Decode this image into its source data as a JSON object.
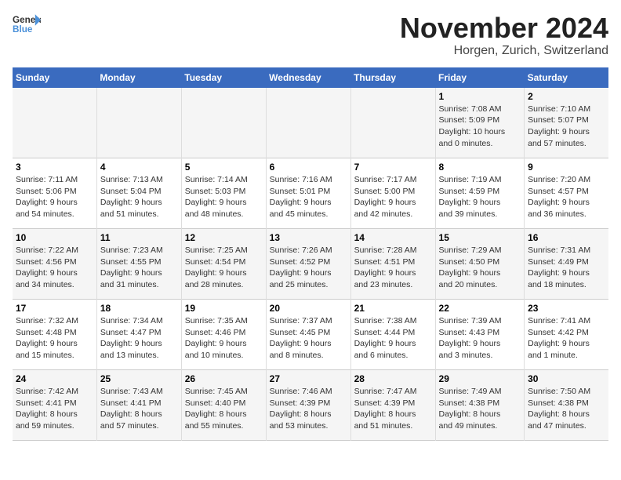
{
  "header": {
    "logo_line1": "General",
    "logo_line2": "Blue",
    "month": "November 2024",
    "location": "Horgen, Zurich, Switzerland"
  },
  "weekdays": [
    "Sunday",
    "Monday",
    "Tuesday",
    "Wednesday",
    "Thursday",
    "Friday",
    "Saturday"
  ],
  "weeks": [
    [
      {
        "day": "",
        "info": ""
      },
      {
        "day": "",
        "info": ""
      },
      {
        "day": "",
        "info": ""
      },
      {
        "day": "",
        "info": ""
      },
      {
        "day": "",
        "info": ""
      },
      {
        "day": "1",
        "info": "Sunrise: 7:08 AM\nSunset: 5:09 PM\nDaylight: 10 hours\nand 0 minutes."
      },
      {
        "day": "2",
        "info": "Sunrise: 7:10 AM\nSunset: 5:07 PM\nDaylight: 9 hours\nand 57 minutes."
      }
    ],
    [
      {
        "day": "3",
        "info": "Sunrise: 7:11 AM\nSunset: 5:06 PM\nDaylight: 9 hours\nand 54 minutes."
      },
      {
        "day": "4",
        "info": "Sunrise: 7:13 AM\nSunset: 5:04 PM\nDaylight: 9 hours\nand 51 minutes."
      },
      {
        "day": "5",
        "info": "Sunrise: 7:14 AM\nSunset: 5:03 PM\nDaylight: 9 hours\nand 48 minutes."
      },
      {
        "day": "6",
        "info": "Sunrise: 7:16 AM\nSunset: 5:01 PM\nDaylight: 9 hours\nand 45 minutes."
      },
      {
        "day": "7",
        "info": "Sunrise: 7:17 AM\nSunset: 5:00 PM\nDaylight: 9 hours\nand 42 minutes."
      },
      {
        "day": "8",
        "info": "Sunrise: 7:19 AM\nSunset: 4:59 PM\nDaylight: 9 hours\nand 39 minutes."
      },
      {
        "day": "9",
        "info": "Sunrise: 7:20 AM\nSunset: 4:57 PM\nDaylight: 9 hours\nand 36 minutes."
      }
    ],
    [
      {
        "day": "10",
        "info": "Sunrise: 7:22 AM\nSunset: 4:56 PM\nDaylight: 9 hours\nand 34 minutes."
      },
      {
        "day": "11",
        "info": "Sunrise: 7:23 AM\nSunset: 4:55 PM\nDaylight: 9 hours\nand 31 minutes."
      },
      {
        "day": "12",
        "info": "Sunrise: 7:25 AM\nSunset: 4:54 PM\nDaylight: 9 hours\nand 28 minutes."
      },
      {
        "day": "13",
        "info": "Sunrise: 7:26 AM\nSunset: 4:52 PM\nDaylight: 9 hours\nand 25 minutes."
      },
      {
        "day": "14",
        "info": "Sunrise: 7:28 AM\nSunset: 4:51 PM\nDaylight: 9 hours\nand 23 minutes."
      },
      {
        "day": "15",
        "info": "Sunrise: 7:29 AM\nSunset: 4:50 PM\nDaylight: 9 hours\nand 20 minutes."
      },
      {
        "day": "16",
        "info": "Sunrise: 7:31 AM\nSunset: 4:49 PM\nDaylight: 9 hours\nand 18 minutes."
      }
    ],
    [
      {
        "day": "17",
        "info": "Sunrise: 7:32 AM\nSunset: 4:48 PM\nDaylight: 9 hours\nand 15 minutes."
      },
      {
        "day": "18",
        "info": "Sunrise: 7:34 AM\nSunset: 4:47 PM\nDaylight: 9 hours\nand 13 minutes."
      },
      {
        "day": "19",
        "info": "Sunrise: 7:35 AM\nSunset: 4:46 PM\nDaylight: 9 hours\nand 10 minutes."
      },
      {
        "day": "20",
        "info": "Sunrise: 7:37 AM\nSunset: 4:45 PM\nDaylight: 9 hours\nand 8 minutes."
      },
      {
        "day": "21",
        "info": "Sunrise: 7:38 AM\nSunset: 4:44 PM\nDaylight: 9 hours\nand 6 minutes."
      },
      {
        "day": "22",
        "info": "Sunrise: 7:39 AM\nSunset: 4:43 PM\nDaylight: 9 hours\nand 3 minutes."
      },
      {
        "day": "23",
        "info": "Sunrise: 7:41 AM\nSunset: 4:42 PM\nDaylight: 9 hours\nand 1 minute."
      }
    ],
    [
      {
        "day": "24",
        "info": "Sunrise: 7:42 AM\nSunset: 4:41 PM\nDaylight: 8 hours\nand 59 minutes."
      },
      {
        "day": "25",
        "info": "Sunrise: 7:43 AM\nSunset: 4:41 PM\nDaylight: 8 hours\nand 57 minutes."
      },
      {
        "day": "26",
        "info": "Sunrise: 7:45 AM\nSunset: 4:40 PM\nDaylight: 8 hours\nand 55 minutes."
      },
      {
        "day": "27",
        "info": "Sunrise: 7:46 AM\nSunset: 4:39 PM\nDaylight: 8 hours\nand 53 minutes."
      },
      {
        "day": "28",
        "info": "Sunrise: 7:47 AM\nSunset: 4:39 PM\nDaylight: 8 hours\nand 51 minutes."
      },
      {
        "day": "29",
        "info": "Sunrise: 7:49 AM\nSunset: 4:38 PM\nDaylight: 8 hours\nand 49 minutes."
      },
      {
        "day": "30",
        "info": "Sunrise: 7:50 AM\nSunset: 4:38 PM\nDaylight: 8 hours\nand 47 minutes."
      }
    ]
  ]
}
